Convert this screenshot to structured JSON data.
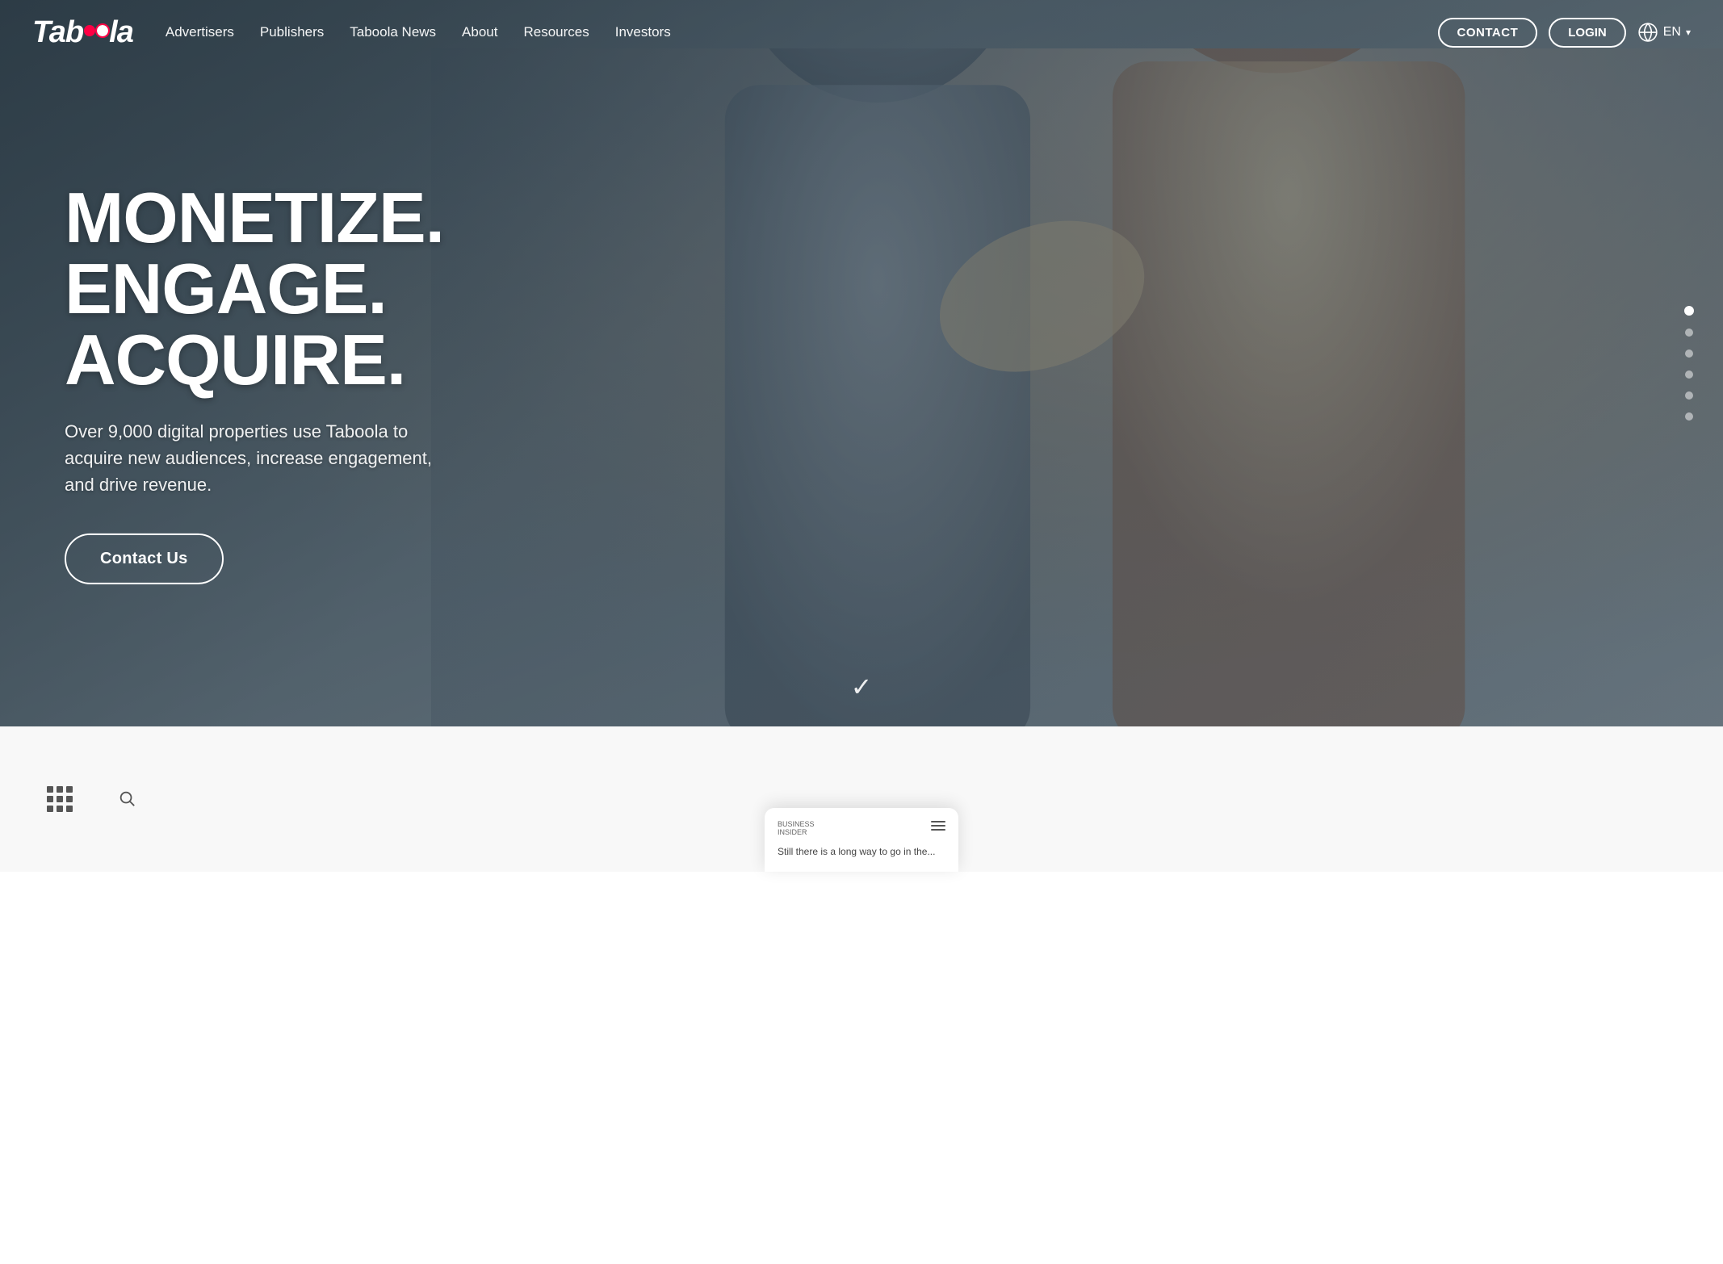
{
  "navbar": {
    "logo": "Taboola",
    "links": [
      {
        "id": "advertisers",
        "label": "Advertisers"
      },
      {
        "id": "publishers",
        "label": "Publishers"
      },
      {
        "id": "taboola-news",
        "label": "Taboola News"
      },
      {
        "id": "about",
        "label": "About"
      },
      {
        "id": "resources",
        "label": "Resources"
      },
      {
        "id": "investors",
        "label": "Investors"
      }
    ],
    "contact_label": "CONTACT",
    "login_label": "LOGIN",
    "lang": "EN"
  },
  "hero": {
    "headline_line1": "MONETIZE.",
    "headline_line2": "ENGAGE.",
    "headline_line3": "ACQUIRE.",
    "subtext": "Over 9,000 digital properties use Taboola to acquire new audiences, increase engagement, and drive revenue.",
    "cta_label": "Contact Us",
    "checkmark": "✓"
  },
  "scroll_dots": [
    {
      "active": true
    },
    {
      "active": false
    },
    {
      "active": false
    },
    {
      "active": false
    },
    {
      "active": false
    },
    {
      "active": false
    }
  ],
  "card_preview": {
    "logo_line1": "BUSINESS",
    "logo_line2": "INSIDER",
    "text": "Still there is a long way to go in the..."
  }
}
